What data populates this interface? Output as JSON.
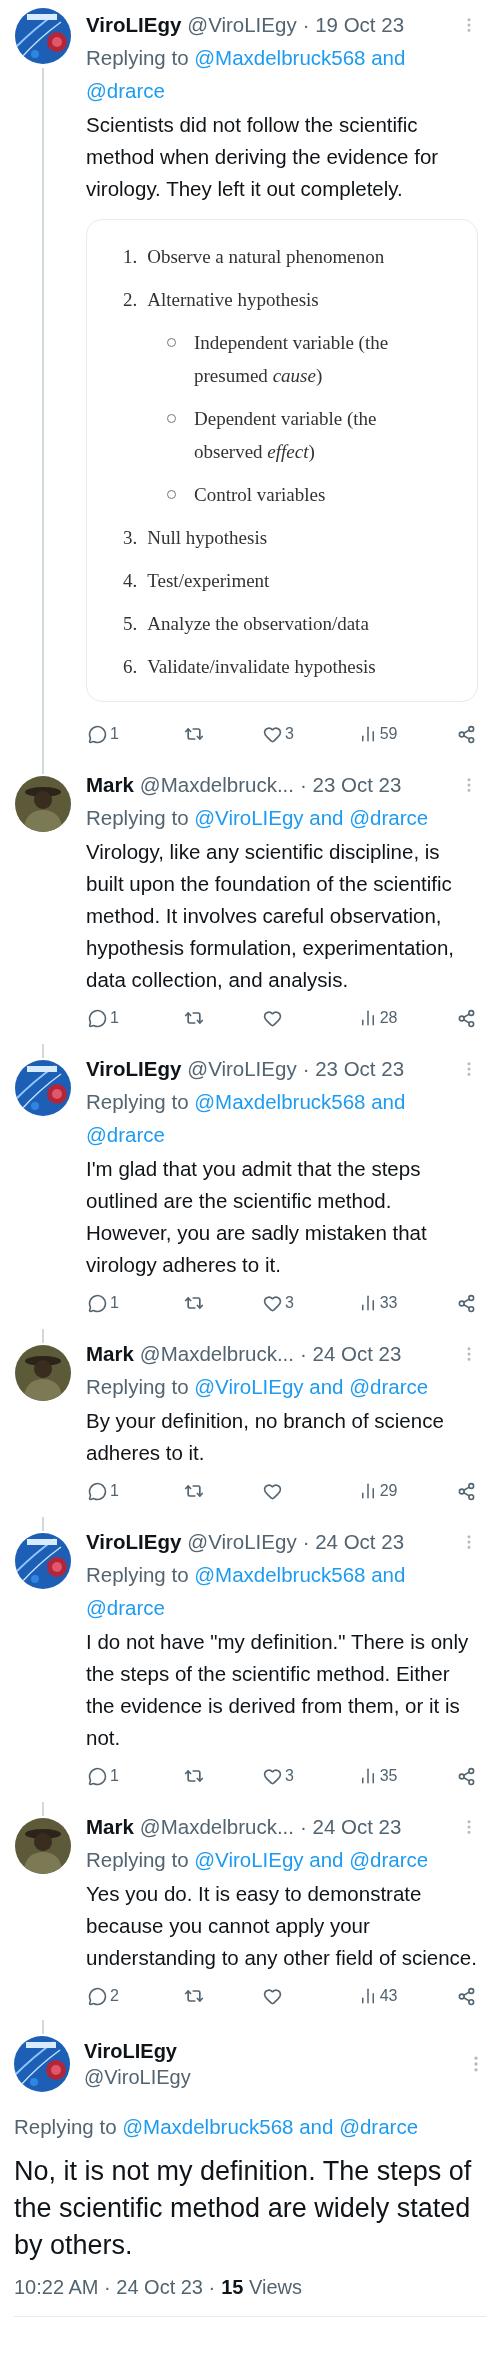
{
  "tweets": [
    {
      "kind": "reply",
      "avatar": {
        "kind": "virus"
      },
      "name": "ViroLIEgy",
      "handle": "@ViroLIEgy",
      "date": "· 19 Oct 23",
      "replying": {
        "label": "Replying to",
        "mentions": [
          "@Maxdelbruck568",
          "@drarce"
        ],
        "joiner": "and"
      },
      "text": "Scientists did not follow the scientific method when deriving the evidence for virology. They left it out completely.",
      "document": {
        "steps": [
          {
            "number": "1.",
            "text": "Observe a natural phenomenon"
          },
          {
            "number": "2.",
            "text": "Alternative hypothesis",
            "children": [
              {
                "text": "Independent variable (the presumed *cause*)"
              },
              {
                "text": "Dependent variable (the observed *effect*)"
              },
              {
                "text": "Control variables"
              }
            ]
          },
          {
            "number": "3.",
            "text": "Null hypothesis"
          },
          {
            "number": "4.",
            "text": "Test/experiment"
          },
          {
            "number": "5.",
            "text": "Analyze the observation/data"
          },
          {
            "number": "6.",
            "text": "Validate/invalidate hypothesis"
          }
        ]
      },
      "actions": {
        "replies": "1",
        "likes": "3",
        "views": "59"
      }
    },
    {
      "kind": "reply",
      "avatar": {
        "kind": "person"
      },
      "name": "Mark",
      "handle": "@Maxdelbruck...",
      "date": "· 23 Oct 23",
      "replying": {
        "label": "Replying to",
        "mentions": [
          "@ViroLIEgy",
          "@drarce"
        ],
        "joiner": "and"
      },
      "text": "Virology, like any scientific discipline, is built upon the foundation of the scientific method. It involves careful observation, hypothesis formulation, experimentation, data collection, and analysis.",
      "actions": {
        "replies": "1",
        "views": "28"
      }
    },
    {
      "kind": "reply",
      "avatar": {
        "kind": "virus"
      },
      "name": "ViroLIEgy",
      "handle": "@ViroLIEgy",
      "date": "· 23 Oct 23",
      "replying": {
        "label": "Replying to",
        "mentions": [
          "@Maxdelbruck568",
          "@drarce"
        ],
        "joiner": "and"
      },
      "text": "I'm glad that you admit that the steps outlined are the scientific method. However, you are sadly mistaken that virology adheres to it.",
      "actions": {
        "replies": "1",
        "likes": "3",
        "views": "33"
      }
    },
    {
      "kind": "reply",
      "avatar": {
        "kind": "person"
      },
      "name": "Mark",
      "handle": "@Maxdelbruck...",
      "date": "· 24 Oct 23",
      "replying": {
        "label": "Replying to",
        "mentions": [
          "@ViroLIEgy",
          "@drarce"
        ],
        "joiner": "and"
      },
      "text": "By your definition, no branch of science adheres to it.",
      "actions": {
        "replies": "1",
        "views": "29"
      }
    },
    {
      "kind": "reply",
      "avatar": {
        "kind": "virus"
      },
      "name": "ViroLIEgy",
      "handle": "@ViroLIEgy",
      "date": "· 24 Oct 23",
      "replying": {
        "label": "Replying to",
        "mentions": [
          "@Maxdelbruck568",
          "@drarce"
        ],
        "joiner": "and"
      },
      "text": "I do not have \"my definition.\" There is only the steps of the scientific method. Either the evidence is derived from them, or it is not.",
      "actions": {
        "replies": "1",
        "likes": "3",
        "views": "35"
      }
    },
    {
      "kind": "reply",
      "avatar": {
        "kind": "person"
      },
      "name": "Mark",
      "handle": "@Maxdelbruck...",
      "date": "· 24 Oct 23",
      "replying": {
        "label": "Replying to",
        "mentions": [
          "@ViroLIEgy",
          "@drarce"
        ],
        "joiner": "and"
      },
      "text": "Yes you do. It is easy to demonstrate because you cannot apply your understanding to any other field of science.",
      "actions": {
        "replies": "2",
        "views": "43"
      }
    },
    {
      "kind": "main",
      "avatar": {
        "kind": "virus"
      },
      "name": "ViroLIEgy",
      "handle": "@ViroLIEgy",
      "replying": {
        "label": "Replying to",
        "mentions": [
          "@Maxdelbruck568",
          "@drarce"
        ],
        "joiner": "and"
      },
      "text": "No, it is not my definition. The steps of the scientific method are widely stated by others.",
      "footer": {
        "time": "10:22 AM · 24 Oct 23 ·",
        "views_count": "15",
        "views_label": "Views"
      }
    }
  ]
}
